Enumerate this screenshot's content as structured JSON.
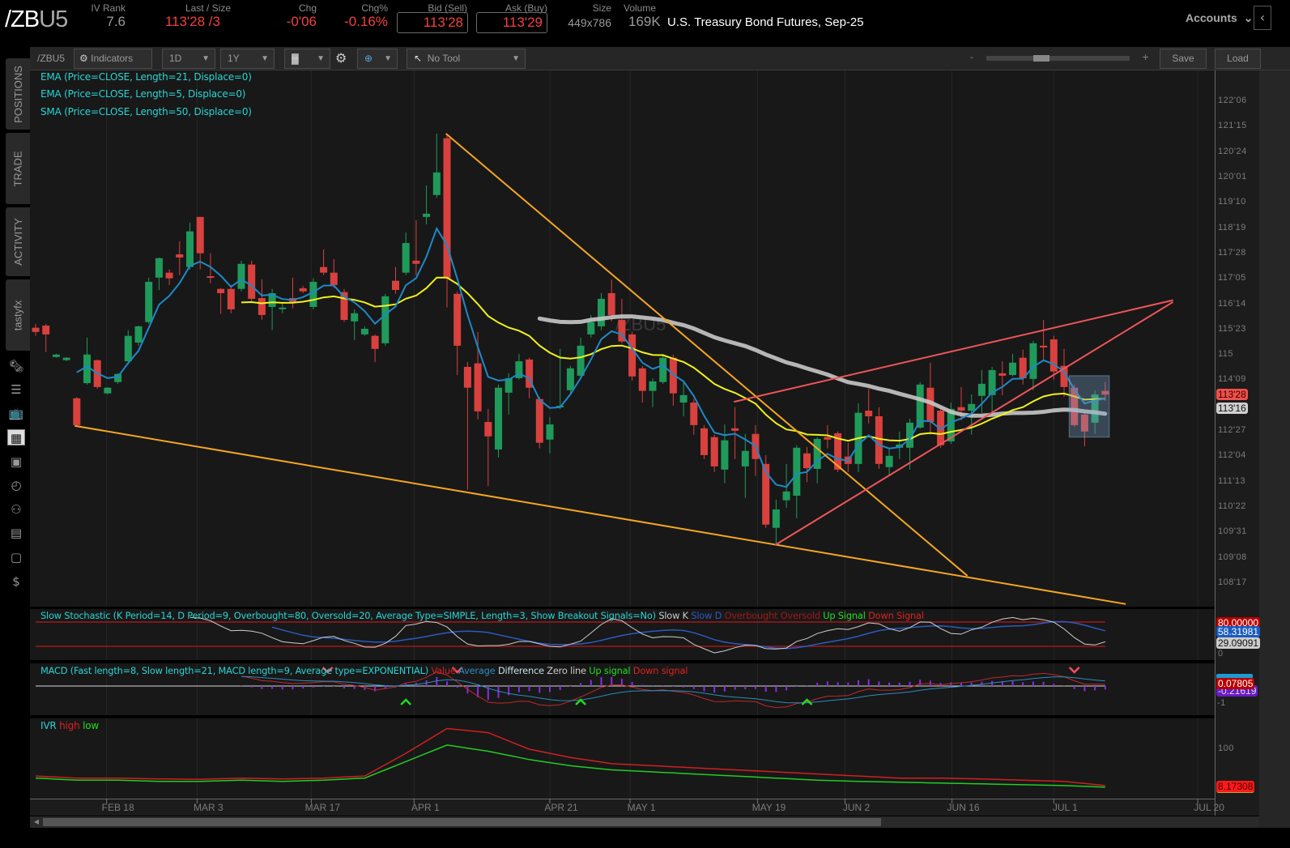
{
  "header": {
    "symbol_root": "/ZB",
    "symbol_suffix": "U5",
    "iv_rank_label": "IV Rank",
    "iv_rank": "7.6",
    "last_label": "Last / Size",
    "last": "113'28 /3",
    "chg_label": "Chg",
    "chg": "-0'06",
    "chgpct_label": "Chg%",
    "chgpct": "-0.16%",
    "bid_label": "Bid (Sell)",
    "bid": "113'28",
    "ask_label": "Ask (Buy)",
    "ask": "113'29",
    "size_label": "Size",
    "size": "449x786",
    "volume_label": "Volume",
    "volume": "169K",
    "description": "U.S. Treasury Bond Futures, Sep-25",
    "accounts": "Accounts"
  },
  "sidebar": {
    "tabs": [
      "POSITIONS",
      "TRADE",
      "ACTIVITY",
      "tastyfx"
    ],
    "icons": [
      "news-icon",
      "watchlist-icon",
      "tv-icon",
      "chart-icon",
      "grid-icon",
      "history-icon",
      "community-icon",
      "calendar-icon",
      "keyboard-icon",
      "help-icon"
    ]
  },
  "toolbar": {
    "symbol": "/ZBU5",
    "indicators": "Indicators",
    "interval": "1D",
    "range": "1Y",
    "tool": "No Tool",
    "zoom_minus": "-",
    "zoom_plus": "+",
    "save": "Save",
    "load": "Load",
    "zoom_level": 0.37
  },
  "studies": [
    "EMA (Price=CLOSE, Length=21, Displace=0)",
    "EMA (Price=CLOSE, Length=5, Displace=0)",
    "SMA (Price=CLOSE, Length=50, Displace=0)"
  ],
  "watermark": "/ZBU5",
  "colors": {
    "up": "#1f9a5a",
    "down": "#d9413e",
    "ema21": "#f2f21a",
    "ema5": "#1e88c8",
    "sma50": "#c8c8c8",
    "trend_orange": "#f5a623",
    "trend_red": "#f0555a",
    "cyan": "#2ad4d4"
  },
  "price_axis": {
    "ticks": [
      {
        "label": "122'06",
        "value": 122.1875
      },
      {
        "label": "121'15",
        "value": 121.46875
      },
      {
        "label": "120'24",
        "value": 120.75
      },
      {
        "label": "120'01",
        "value": 120.03125
      },
      {
        "label": "119'10",
        "value": 119.3125
      },
      {
        "label": "118'19",
        "value": 118.59375
      },
      {
        "label": "117'28",
        "value": 117.875
      },
      {
        "label": "117'05",
        "value": 117.15625
      },
      {
        "label": "116'14",
        "value": 116.4375
      },
      {
        "label": "115'23",
        "value": 115.71875
      },
      {
        "label": "115",
        "value": 115.0
      },
      {
        "label": "114'09",
        "value": 114.28125
      },
      {
        "label": "112'27",
        "value": 112.84375
      },
      {
        "label": "112'04",
        "value": 112.125
      },
      {
        "label": "111'13",
        "value": 111.40625
      },
      {
        "label": "110'22",
        "value": 110.6875
      },
      {
        "label": "109'31",
        "value": 109.96875
      },
      {
        "label": "109'08",
        "value": 109.25
      },
      {
        "label": "108'17",
        "value": 108.53125
      }
    ],
    "last_tag": {
      "label": "113'28",
      "value": 113.875
    },
    "sma_tag": {
      "label": "113'16",
      "value": 113.5
    }
  },
  "x_axis": [
    {
      "label": "FEB 18",
      "bar": 6.9
    },
    {
      "label": "MAR 3",
      "bar": 15.7
    },
    {
      "label": "MAR 17",
      "bar": 26.8
    },
    {
      "label": "APR 1",
      "bar": 36.8
    },
    {
      "label": "APR 21",
      "bar": 50
    },
    {
      "label": "MAY 1",
      "bar": 57.8
    },
    {
      "label": "MAY 19",
      "bar": 70.2
    },
    {
      "label": "JUN 2",
      "bar": 78.7
    },
    {
      "label": "JUN 16",
      "bar": 89.1
    },
    {
      "label": "JUL 1",
      "bar": 99
    },
    {
      "label": "JUL 20",
      "bar": 113
    }
  ],
  "chart_data": {
    "type": "candlestick",
    "ohlc_fields": [
      "open",
      "high",
      "low",
      "close"
    ],
    "candles": [
      [
        115.77,
        115.88,
        115.54,
        115.65
      ],
      [
        115.83,
        115.88,
        115.08,
        115.58
      ],
      [
        114.94,
        115.03,
        114.92,
        115.01
      ],
      [
        114.85,
        114.94,
        114.82,
        114.92
      ],
      [
        113.77,
        113.81,
        112.97,
        113.01
      ],
      [
        114.2,
        115.49,
        114.16,
        115.01
      ],
      [
        114.85,
        114.87,
        114.04,
        114.09
      ],
      [
        113.91,
        114.09,
        113.88,
        114.07
      ],
      [
        114.23,
        114.48,
        114.18,
        114.46
      ],
      [
        114.82,
        115.7,
        114.78,
        115.54
      ],
      [
        115.35,
        115.83,
        115.26,
        115.81
      ],
      [
        115.93,
        117.19,
        115.88,
        117.07
      ],
      [
        117.19,
        117.76,
        116.84,
        117.74
      ],
      [
        117.33,
        117.42,
        116.98,
        117.17
      ],
      [
        117.85,
        118.22,
        117.26,
        117.76
      ],
      [
        117.49,
        118.75,
        117.42,
        118.5
      ],
      [
        118.91,
        118.91,
        117.42,
        117.88
      ],
      [
        117.23,
        117.88,
        117.03,
        117.19
      ],
      [
        116.87,
        116.89,
        116.16,
        116.75
      ],
      [
        116.87,
        116.98,
        116.18,
        116.29
      ],
      [
        116.87,
        117.67,
        116.8,
        117.58
      ],
      [
        117.56,
        117.67,
        116.5,
        116.59
      ],
      [
        116.61,
        117.14,
        116.0,
        116.13
      ],
      [
        116.36,
        116.87,
        115.7,
        116.75
      ],
      [
        116.32,
        116.45,
        116.18,
        116.34
      ],
      [
        116.61,
        117.19,
        116.32,
        116.5
      ],
      [
        116.89,
        116.95,
        116.75,
        116.8
      ],
      [
        116.36,
        117.17,
        116.29,
        117.07
      ],
      [
        117.49,
        117.99,
        117.26,
        117.33
      ],
      [
        117.33,
        117.72,
        116.89,
        116.98
      ],
      [
        116.78,
        116.87,
        115.93,
        115.99
      ],
      [
        115.95,
        116.29,
        115.42,
        116.18
      ],
      [
        115.58,
        115.81,
        115.54,
        115.74
      ],
      [
        115.54,
        115.58,
        114.8,
        115.17
      ],
      [
        115.33,
        116.73,
        115.26,
        116.66
      ],
      [
        117.1,
        117.49,
        116.73,
        116.84
      ],
      [
        117.33,
        118.47,
        117.26,
        118.17
      ],
      [
        117.67,
        118.82,
        117.26,
        117.58
      ],
      [
        118.91,
        119.8,
        118.7,
        119.0
      ],
      [
        119.53,
        121.27,
        119.45,
        120.17
      ],
      [
        121.14,
        121.27,
        116.34,
        117.17
      ],
      [
        116.73,
        116.8,
        114.43,
        115.26
      ],
      [
        114.66,
        114.8,
        111.18,
        114.07
      ],
      [
        114.76,
        115.65,
        113.17,
        113.4
      ],
      [
        113.1,
        113.47,
        111.29,
        112.69
      ],
      [
        112.32,
        114.16,
        112.09,
        114.07
      ],
      [
        113.93,
        114.48,
        113.31,
        114.34
      ],
      [
        114.34,
        115.03,
        114.3,
        114.82
      ],
      [
        114.87,
        114.92,
        113.77,
        114.07
      ],
      [
        113.75,
        113.81,
        112.35,
        112.51
      ],
      [
        112.6,
        113.24,
        112.21,
        113.03
      ],
      [
        113.52,
        115.17,
        113.47,
        113.56
      ],
      [
        114.0,
        114.69,
        113.91,
        114.62
      ],
      [
        114.41,
        115.49,
        114.34,
        115.26
      ],
      [
        115.58,
        116.13,
        115.49,
        115.93
      ],
      [
        115.81,
        116.75,
        115.7,
        116.59
      ],
      [
        116.75,
        117.14,
        115.95,
        116.13
      ],
      [
        115.99,
        116.59,
        115.33,
        115.38
      ],
      [
        115.58,
        115.65,
        114.27,
        114.39
      ],
      [
        114.62,
        114.69,
        113.65,
        113.98
      ],
      [
        113.98,
        114.34,
        113.52,
        114.25
      ],
      [
        114.23,
        115.03,
        114.18,
        114.92
      ],
      [
        114.92,
        115.01,
        113.56,
        113.91
      ],
      [
        113.65,
        114.27,
        113.26,
        113.86
      ],
      [
        113.65,
        113.75,
        112.74,
        113.01
      ],
      [
        112.92,
        113.01,
        112.05,
        112.16
      ],
      [
        112.67,
        112.74,
        111.68,
        111.84
      ],
      [
        111.75,
        113.03,
        111.36,
        112.58
      ],
      [
        112.92,
        113.52,
        112.05,
        112.85
      ],
      [
        111.84,
        112.76,
        110.95,
        112.28
      ],
      [
        112.76,
        113.01,
        111.57,
        112.05
      ],
      [
        111.91,
        112.16,
        110.1,
        110.19
      ],
      [
        110.1,
        110.9,
        109.64,
        110.62
      ],
      [
        110.88,
        111.91,
        110.67,
        111.13
      ],
      [
        111.01,
        112.44,
        110.37,
        112.37
      ],
      [
        112.21,
        112.39,
        111.4,
        111.79
      ],
      [
        111.77,
        112.67,
        111.36,
        112.62
      ],
      [
        112.67,
        113.01,
        112.35,
        112.6
      ],
      [
        112.78,
        112.83,
        111.68,
        111.75
      ],
      [
        112.12,
        112.51,
        111.68,
        111.91
      ],
      [
        111.91,
        113.63,
        111.68,
        113.36
      ],
      [
        113.42,
        114.04,
        113.06,
        113.26
      ],
      [
        113.26,
        113.52,
        111.77,
        111.91
      ],
      [
        111.82,
        112.35,
        111.59,
        112.14
      ],
      [
        112.37,
        112.83,
        112.05,
        112.46
      ],
      [
        112.37,
        113.19,
        111.75,
        113.08
      ],
      [
        112.94,
        114.23,
        112.9,
        114.16
      ],
      [
        114.07,
        114.78,
        112.74,
        113.1
      ],
      [
        113.42,
        113.5,
        112.37,
        112.44
      ],
      [
        112.55,
        113.65,
        112.48,
        113.47
      ],
      [
        113.52,
        114.09,
        113.15,
        113.42
      ],
      [
        113.42,
        113.88,
        112.74,
        113.61
      ],
      [
        113.84,
        114.57,
        113.36,
        114.18
      ],
      [
        113.86,
        114.66,
        113.29,
        114.57
      ],
      [
        114.48,
        114.82,
        113.86,
        114.41
      ],
      [
        114.43,
        115.03,
        114.4,
        114.78
      ],
      [
        114.92,
        115.15,
        114.16,
        114.34
      ],
      [
        114.32,
        115.4,
        114.0,
        115.33
      ],
      [
        115.26,
        115.99,
        114.85,
        115.21
      ],
      [
        115.44,
        115.54,
        114.3,
        114.53
      ],
      [
        114.69,
        115.17,
        113.81,
        114.09
      ],
      [
        114.07,
        114.16,
        112.97,
        113.01
      ],
      [
        113.31,
        113.4,
        112.41,
        112.83
      ],
      [
        113.08,
        114.0,
        112.76,
        113.88
      ],
      [
        113.98,
        114.23,
        113.7,
        113.875
      ]
    ],
    "moving_averages": [
      {
        "name": "EMA21",
        "length": 21
      },
      {
        "name": "EMA5",
        "length": 5
      },
      {
        "name": "SMA50",
        "length": 50
      }
    ],
    "trendlines": [
      {
        "color": "orange",
        "from": [
          3.8,
          112.99
        ],
        "to": [
          106,
          107.94
        ]
      },
      {
        "color": "orange",
        "from": [
          39.9,
          121.27
        ],
        "to": [
          90.6,
          108.74
        ]
      },
      {
        "color": "red",
        "from": [
          67.9,
          113.67
        ],
        "to": [
          110.6,
          116.55
        ]
      },
      {
        "color": "red",
        "from": [
          71.9,
          109.61
        ],
        "to": [
          110.6,
          116.5
        ]
      }
    ],
    "highlight_box": {
      "from_bar": 100.5,
      "to_bar": 104.4,
      "price_high": 114.41,
      "price_low": 112.67
    }
  },
  "stochastic": {
    "legend": "Slow Stochastic (K Period=14, D Period=9, Overbought=80, Oversold=20, Average Type=SIMPLE, Length=3, Show Breakout Signals=No)",
    "items": [
      "Slow K",
      "Slow D",
      "Overbought",
      "Oversold",
      "Up Signal",
      "Down Signal"
    ],
    "k_period": 14,
    "d_period": 9,
    "smooth": 3,
    "overbought": 80,
    "oversold": 20,
    "readouts": {
      "overbought": "80.00000",
      "slow_d": "58.31981",
      "slow_k": "29.09091",
      "zero": "0"
    }
  },
  "macd": {
    "legend": "MACD (Fast length=8, Slow length=21, MACD length=9, Average type=EXPONENTIAL)",
    "items": [
      "Value",
      "Average",
      "Difference",
      "Zero line",
      "Up signal",
      "Down signal"
    ],
    "fast": 8,
    "slow": 21,
    "signal": 9,
    "up_signals": [
      36,
      53,
      75
    ],
    "down_signals": [
      28.4,
      41,
      101
    ],
    "readouts": {
      "value": "0.07805",
      "diff": "-0.21619",
      "minus_one": "-1"
    }
  },
  "ivr": {
    "legend": "IVR",
    "high_label": "high",
    "low_label": "low",
    "sample_step_bars": 4,
    "high": [
      35,
      30,
      30,
      28,
      27,
      30,
      28,
      30,
      35,
      90,
      150,
      140,
      100,
      80,
      65,
      60,
      55,
      50,
      45,
      40,
      35,
      30,
      30,
      28,
      25,
      22,
      12
    ],
    "low": [
      30,
      25,
      25,
      22,
      22,
      25,
      22,
      25,
      30,
      70,
      110,
      95,
      75,
      60,
      50,
      45,
      40,
      35,
      30,
      25,
      22,
      20,
      18,
      16,
      14,
      12,
      8
    ],
    "axis_label": "100",
    "readout": "8.17308"
  },
  "scrollbar": {
    "position": 0.0,
    "visible_fraction": 0.69
  }
}
